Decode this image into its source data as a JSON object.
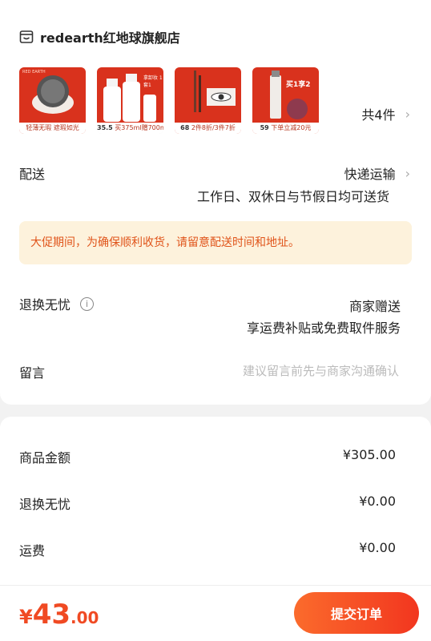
{
  "shop": {
    "name": "redearth红地球旗舰店",
    "icon": "shop-icon"
  },
  "items": [
    {
      "name": "item-cushion",
      "badge": "轻薄无瑕 遮瑕如光",
      "brand": "RED EARTH"
    },
    {
      "name": "item-remover",
      "badge": "买375ml赠700ml",
      "price": "35.5",
      "tag": "拿卸妆 1套1"
    },
    {
      "name": "item-eyeliner",
      "badge": "2件8折/3件7折",
      "price": "68"
    },
    {
      "name": "item-primer",
      "badge": "下单立减20元",
      "price": "59",
      "tag": "买1享2"
    }
  ],
  "items_count": "共4件",
  "delivery": {
    "label": "配送",
    "method": "快递运输",
    "note": "工作日、双休日与节假日均可送货"
  },
  "notice": "大促期间，为确保顺利收货，请留意配送时间和地址。",
  "return_service": {
    "label": "退换无忧",
    "line1": "商家赠送",
    "line2": "享运费补贴或免费取件服务"
  },
  "message": {
    "label": "留言",
    "placeholder": "建议留言前先与商家沟通确认"
  },
  "summary": [
    {
      "label": "商品金额",
      "value": "¥305.00"
    },
    {
      "label": "退换无忧",
      "value": "¥0.00"
    },
    {
      "label": "运费",
      "value": "¥0.00"
    }
  ],
  "total": {
    "yen": "¥",
    "integer": "43",
    "cents": ".00"
  },
  "submit_label": "提交订单",
  "colors": {
    "accent": "#f2361f",
    "notice_bg": "#fdf2dc",
    "notice_text": "#e0541a"
  }
}
